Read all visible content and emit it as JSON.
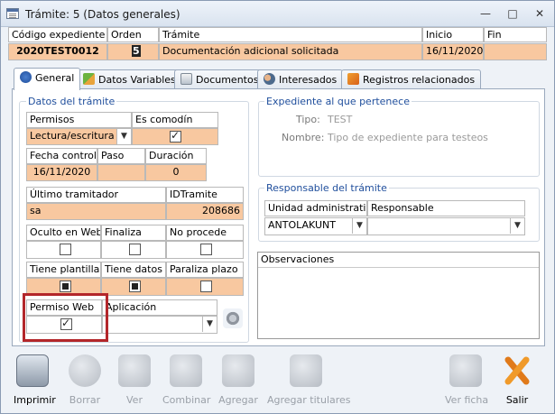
{
  "window": {
    "title": "Trámite: 5 (Datos generales)"
  },
  "header": {
    "labels": [
      "Código expediente",
      "Orden",
      "Trámite",
      "Inicio",
      "Fin"
    ],
    "codigo": "2020TEST0012",
    "orden": "5",
    "tramite": "Documentación adicional solicitada",
    "inicio": "16/11/2020",
    "fin": ""
  },
  "tabs": [
    {
      "label": "General",
      "icon": "general-tab-icon",
      "active": true
    },
    {
      "label": "Datos Variables",
      "icon": "variables-tab-icon"
    },
    {
      "label": "Documentos",
      "icon": "documents-tab-icon"
    },
    {
      "label": "Interesados",
      "icon": "people-tab-icon"
    },
    {
      "label": "Registros relacionados",
      "icon": "related-records-tab-icon"
    }
  ],
  "datos": {
    "title": "Datos del trámite",
    "permisos_label": "Permisos",
    "permisos_value": "Lectura/escritura",
    "comodin_label": "Es comodín",
    "comodin_checked": true,
    "fecha_control_label": "Fecha control",
    "fecha_control": "16/11/2020",
    "paso_label": "Paso",
    "paso": "",
    "duracion_label": "Duración",
    "duracion": "0",
    "ultimo_label": "Último tramitador",
    "ultimo": "sa",
    "idtramite_label": "IDTramite",
    "idtramite": "208686",
    "oculto_label": "Oculto en Web",
    "finaliza_label": "Finaliza",
    "noprocede_label": "No procede",
    "tiene_plantillas_label": "Tiene plantillas",
    "tiene_datos_label": "Tiene datos",
    "paraliza_label": "Paraliza plazo",
    "permiso_web_label": "Permiso Web",
    "permiso_web_checked": true,
    "aplicacion_label": "Aplicación",
    "aplicacion": ""
  },
  "expediente": {
    "title": "Expediente al que pertenece",
    "tipo_label": "Tipo:",
    "tipo": "TEST",
    "nombre_label": "Nombre:",
    "nombre": "Tipo de expediente para testeos"
  },
  "responsable": {
    "title": "Responsable del trámite",
    "unidad_label": "Unidad administrativa",
    "unidad": "ANTOLAKUNT",
    "responsable_label": "Responsable",
    "responsable": ""
  },
  "observaciones": {
    "label": "Observaciones",
    "text": ""
  },
  "toolbar": {
    "imprimir": "Imprimir",
    "borrar": "Borrar",
    "ver": "Ver",
    "combinar": "Combinar",
    "agregar": "Agregar",
    "agregar_titulares": "Agregar titulares",
    "ver_ficha": "Ver ficha",
    "salir": "Salir"
  }
}
